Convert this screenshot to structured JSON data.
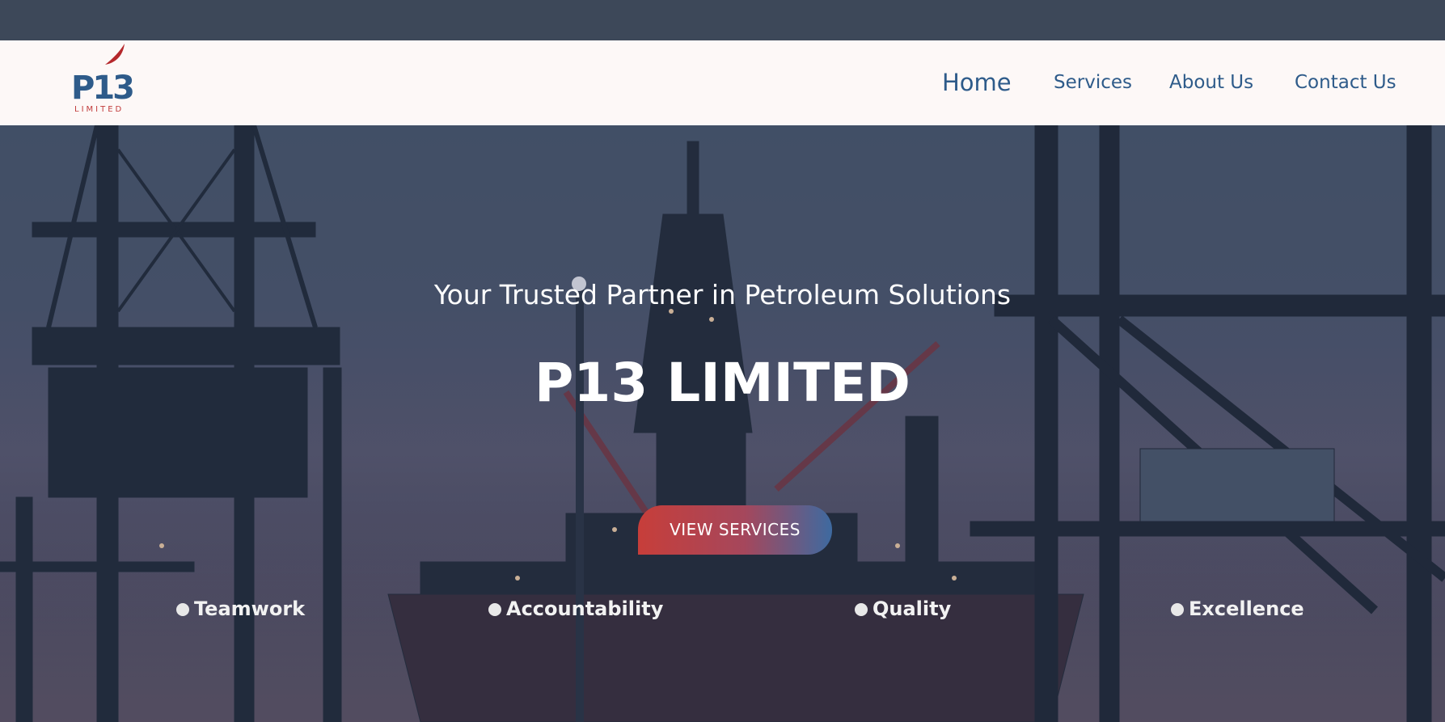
{
  "header": {
    "logo_text": "P13",
    "logo_subtext": "LIMITED"
  },
  "nav": {
    "items": [
      {
        "label": "Home"
      },
      {
        "label": "Services"
      },
      {
        "label": "About Us"
      },
      {
        "label": "Contact Us"
      }
    ]
  },
  "hero": {
    "tagline": "Your Trusted Partner in Petroleum Solutions",
    "title": "P13 LIMITED",
    "cta_label": "VIEW SERVICES",
    "values": [
      {
        "label": "Teamwork"
      },
      {
        "label": "Accountability"
      },
      {
        "label": "Quality"
      },
      {
        "label": "Excellence"
      }
    ]
  },
  "colors": {
    "topbar": "#3d4859",
    "header_bg": "#fdf8f7",
    "nav_text": "#2e5b8a",
    "brand_red": "#c73e3a",
    "brand_blue": "#3e6aa0"
  },
  "icons": {
    "logo_mark": "flame-swoosh-icon",
    "value_bullet": "circle-bullet-icon"
  }
}
